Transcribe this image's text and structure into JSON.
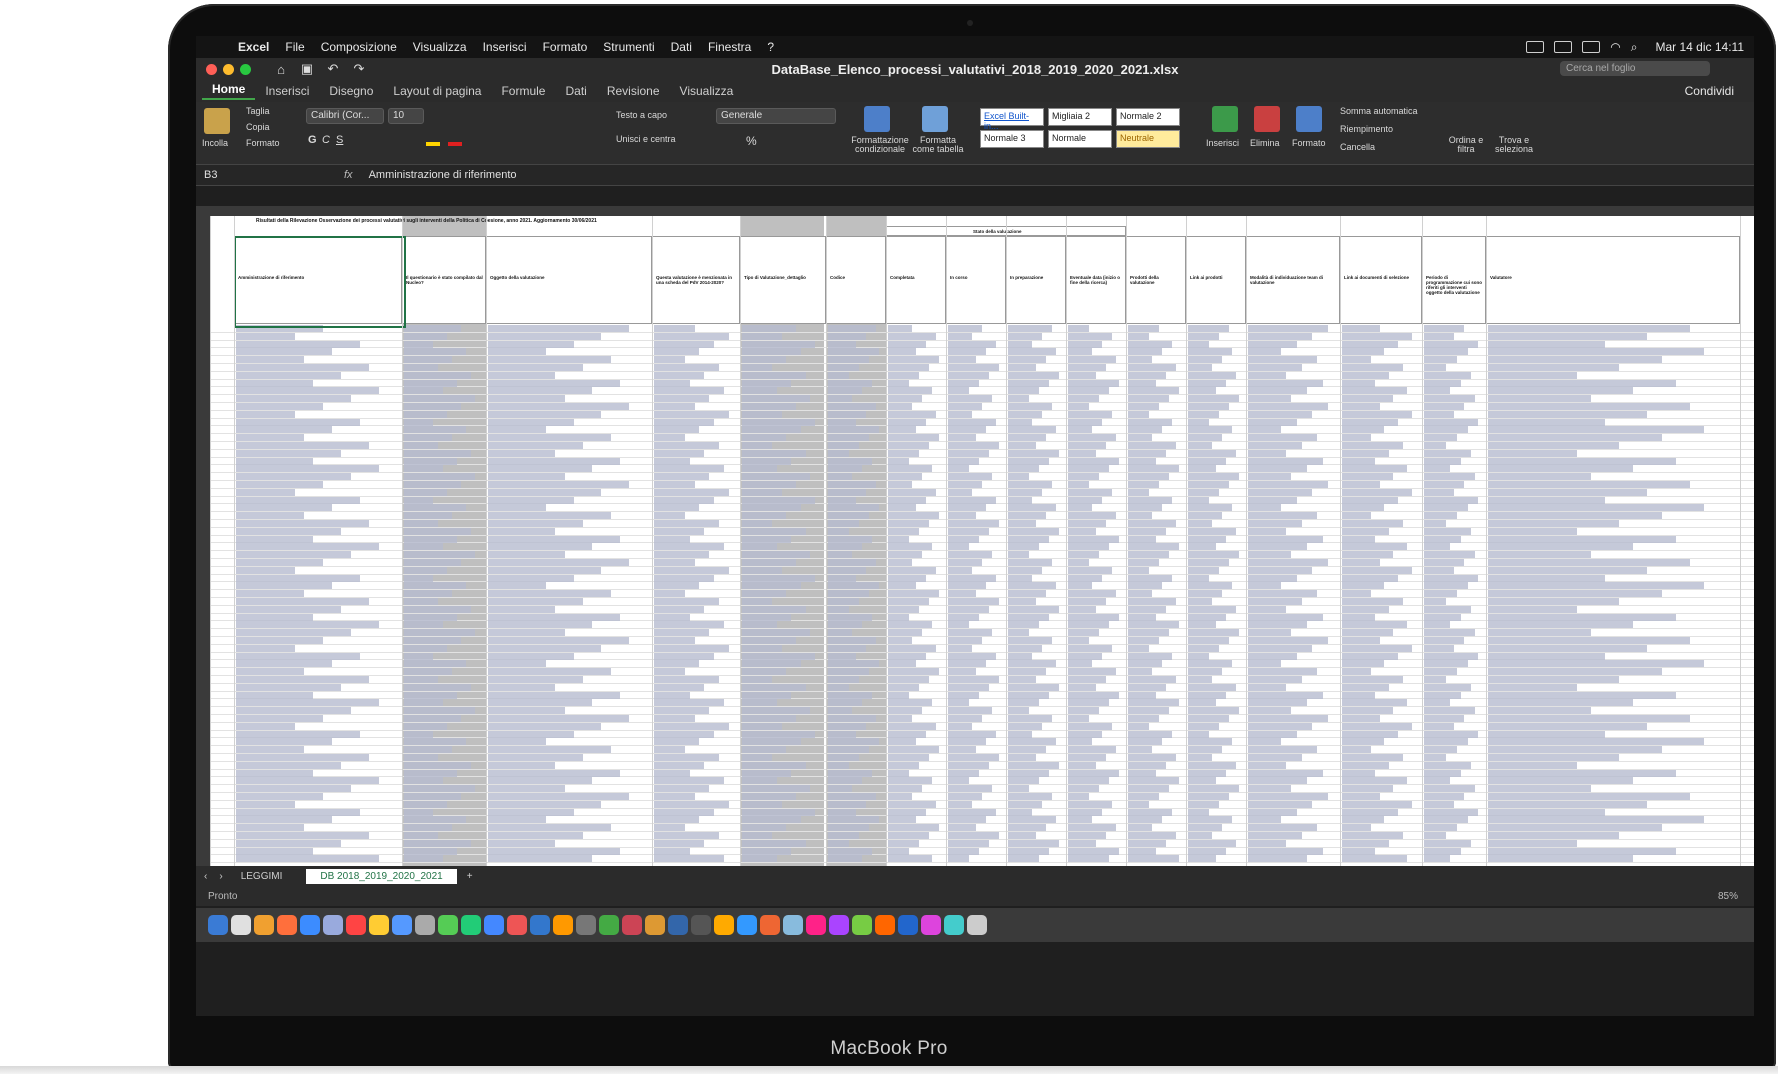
{
  "device": {
    "label": "MacBook Pro"
  },
  "menubar": {
    "app": "Excel",
    "items": [
      "File",
      "Composizione",
      "Visualizza",
      "Inserisci",
      "Formato",
      "Strumenti",
      "Dati",
      "Finestra",
      "?"
    ],
    "clock": "Mar 14 dic 14:11"
  },
  "titlebar": {
    "document": "DataBase_Elenco_processi_valutativi_2018_2019_2020_2021.xlsx",
    "search_placeholder": "Cerca nel foglio"
  },
  "ribbon_tabs": {
    "items": [
      "Home",
      "Inserisci",
      "Disegno",
      "Layout di pagina",
      "Formule",
      "Dati",
      "Revisione",
      "Visualizza"
    ],
    "active": "Home",
    "share": "Condividi"
  },
  "ribbon": {
    "paste": "Incolla",
    "cut": "Taglia",
    "copy": "Copia",
    "format_painter": "Formato",
    "font_name": "Calibri (Cor...",
    "font_size": "10",
    "wrap_text": "Testo a capo",
    "merge_center": "Unisci e centra",
    "number_format": "Generale",
    "conditional_formatting": "Formattazione condizionale",
    "format_as_table": "Formatta come tabella",
    "styles": [
      "Excel Built-in...",
      "Migliaia 2",
      "Normale 2",
      "Normale 3",
      "Normale",
      "Neutrale"
    ],
    "insert": "Inserisci",
    "delete": "Elimina",
    "format": "Formato",
    "autosum": "Somma automatica",
    "fill": "Riempimento",
    "clear": "Cancella",
    "sort_filter": "Ordina e filtra",
    "find_select": "Trova e seleziona"
  },
  "formula_bar": {
    "cell_ref": "B3",
    "content": "Amministrazione di riferimento"
  },
  "sheet": {
    "title_row": "Risultati della Rilevazione Osservazione dei processi valutativi sugli interventi della Politica di Coesione, anno 2021. Aggiornamento 30/06/2021",
    "group_header": "Stato della valutazione",
    "headers": [
      "Amministrazione di riferimento",
      "Il questionario è stato compilato dal Nucleo?",
      "Oggetto della valutazione",
      "Questa valutazione è menzionata in una scheda del PdV 2014-2020?",
      "Tipo di Valutazione_dettaglio",
      "Codice",
      "Completata",
      "In corso",
      "In preparazione",
      "Eventuale data (inizio o fine della ricerca)",
      "Prodotti della valutazione",
      "Link ai prodotti",
      "Modalità di individuazione team di valutazione",
      "Link ai documenti di selezione",
      "Periodo di programmazione cui sono riferiti gli interventi oggetto della valutazione",
      "Valutatore"
    ]
  },
  "sheet_tabs": {
    "items": [
      "LEGGIMI",
      "DB 2018_2019_2020_2021"
    ],
    "active": "DB 2018_2019_2020_2021"
  },
  "status": {
    "ready": "Pronto",
    "zoom": "85%"
  },
  "colors": {
    "excel_green": "#217346",
    "header_grey": "#bfbfbf",
    "neutral_style": "#ffeb9c"
  }
}
